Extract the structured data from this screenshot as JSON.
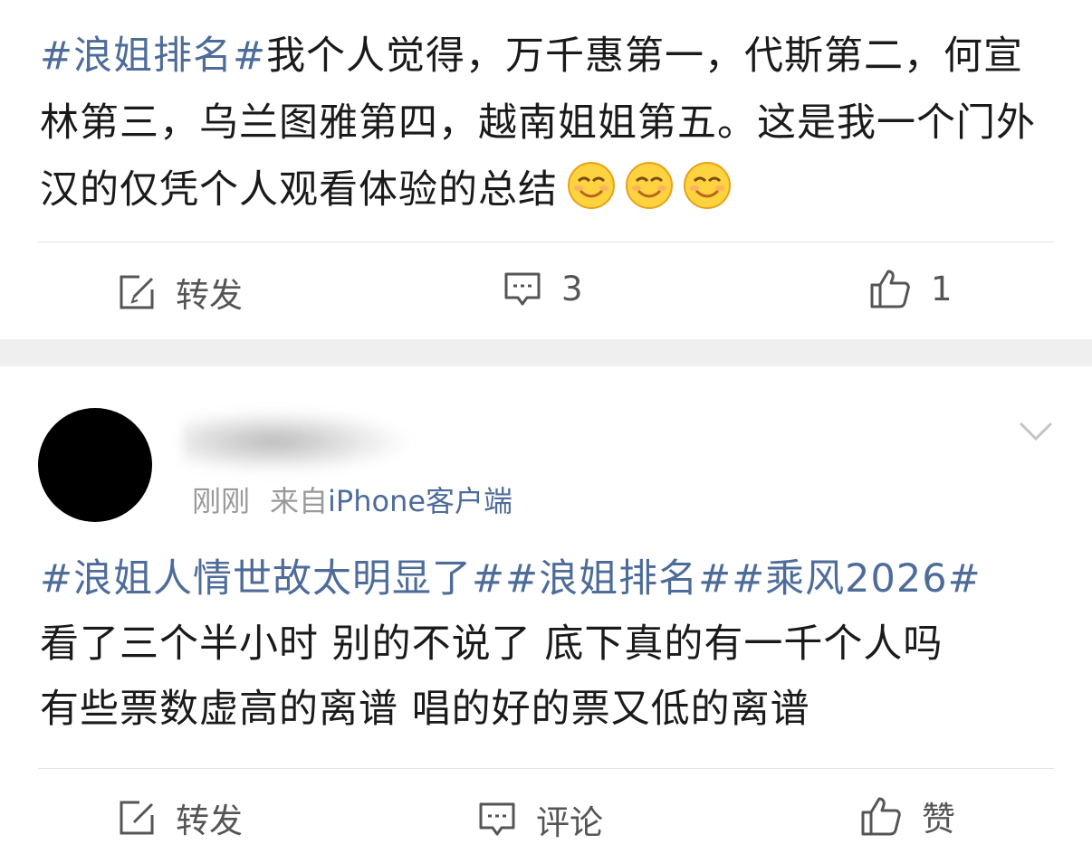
{
  "post1": {
    "topic": "#浪姐排名#",
    "text": "我个人觉得，万千惠第一，代斯第二，何宣林第三，乌兰图雅第四，越南姐姐第五。这是我一个门外汉的仅凭个人观看体验的总结",
    "emojis": [
      "smiling-face-icon",
      "smiling-face-icon",
      "smiling-face-icon"
    ],
    "actions": {
      "repost_label": "转发",
      "comment_count": "3",
      "like_count": "1"
    }
  },
  "post2": {
    "meta": {
      "time": "刚刚",
      "source_prefix": "来自",
      "source": "iPhone客户端"
    },
    "topics": "#浪姐人情世故太明显了##浪姐排名##乘风2026#",
    "body_line1": "看了三个半小时 别的不说了 底下真的有一千个人吗",
    "body_line2": "有些票数虚高的离谱 唱的好的票又低的离谱",
    "actions": {
      "repost_label": "转发",
      "comment_label": "评论",
      "like_label": "赞"
    }
  },
  "colors": {
    "topic": "#4e6c9a",
    "separator": "#efefef",
    "meta": "#9a9a9a"
  }
}
